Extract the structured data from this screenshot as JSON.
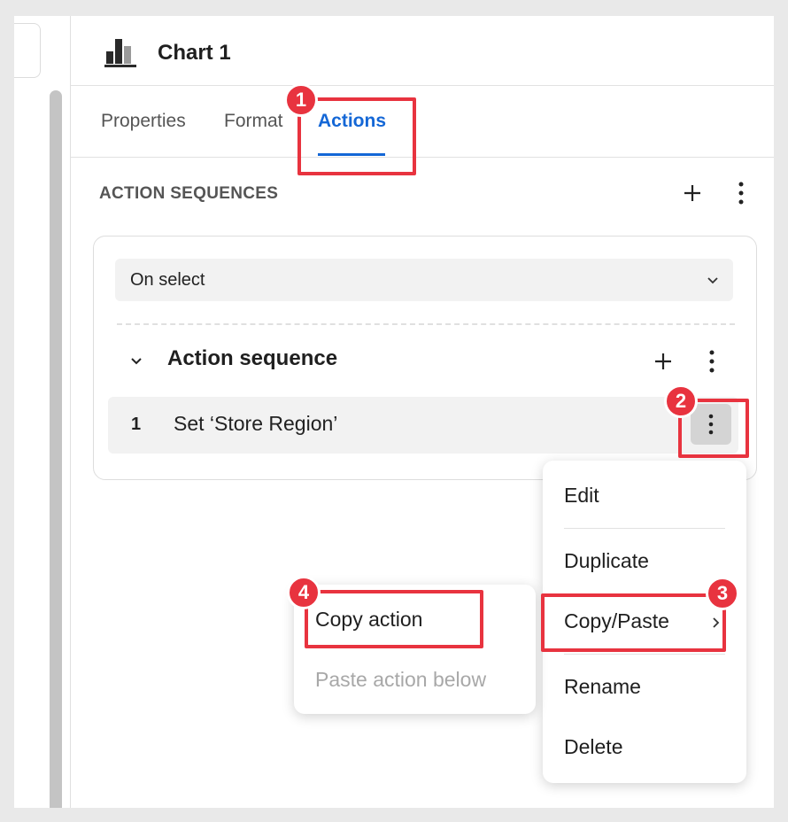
{
  "header": {
    "title": "Chart 1",
    "icon": "bar-chart-icon"
  },
  "tabs": [
    {
      "label": "Properties"
    },
    {
      "label": "Format"
    },
    {
      "label": "Actions",
      "active": true
    }
  ],
  "section": {
    "title": "ACTION SEQUENCES"
  },
  "trigger": {
    "selected": "On select"
  },
  "sequence": {
    "title": "Action sequence",
    "actions": [
      {
        "index": "1",
        "label": "Set ‘Store Region’"
      }
    ]
  },
  "context_menu": {
    "items": [
      "Edit",
      "Duplicate",
      "Copy/Paste",
      "Rename",
      "Delete"
    ]
  },
  "submenu": {
    "items": [
      {
        "label": "Copy action",
        "enabled": true
      },
      {
        "label": "Paste action below",
        "enabled": false
      }
    ]
  },
  "annotations": {
    "badges": [
      "1",
      "2",
      "3",
      "4"
    ],
    "color": "#e8333f"
  },
  "colors": {
    "accent": "#1467d6",
    "highlight": "#e8333f"
  }
}
